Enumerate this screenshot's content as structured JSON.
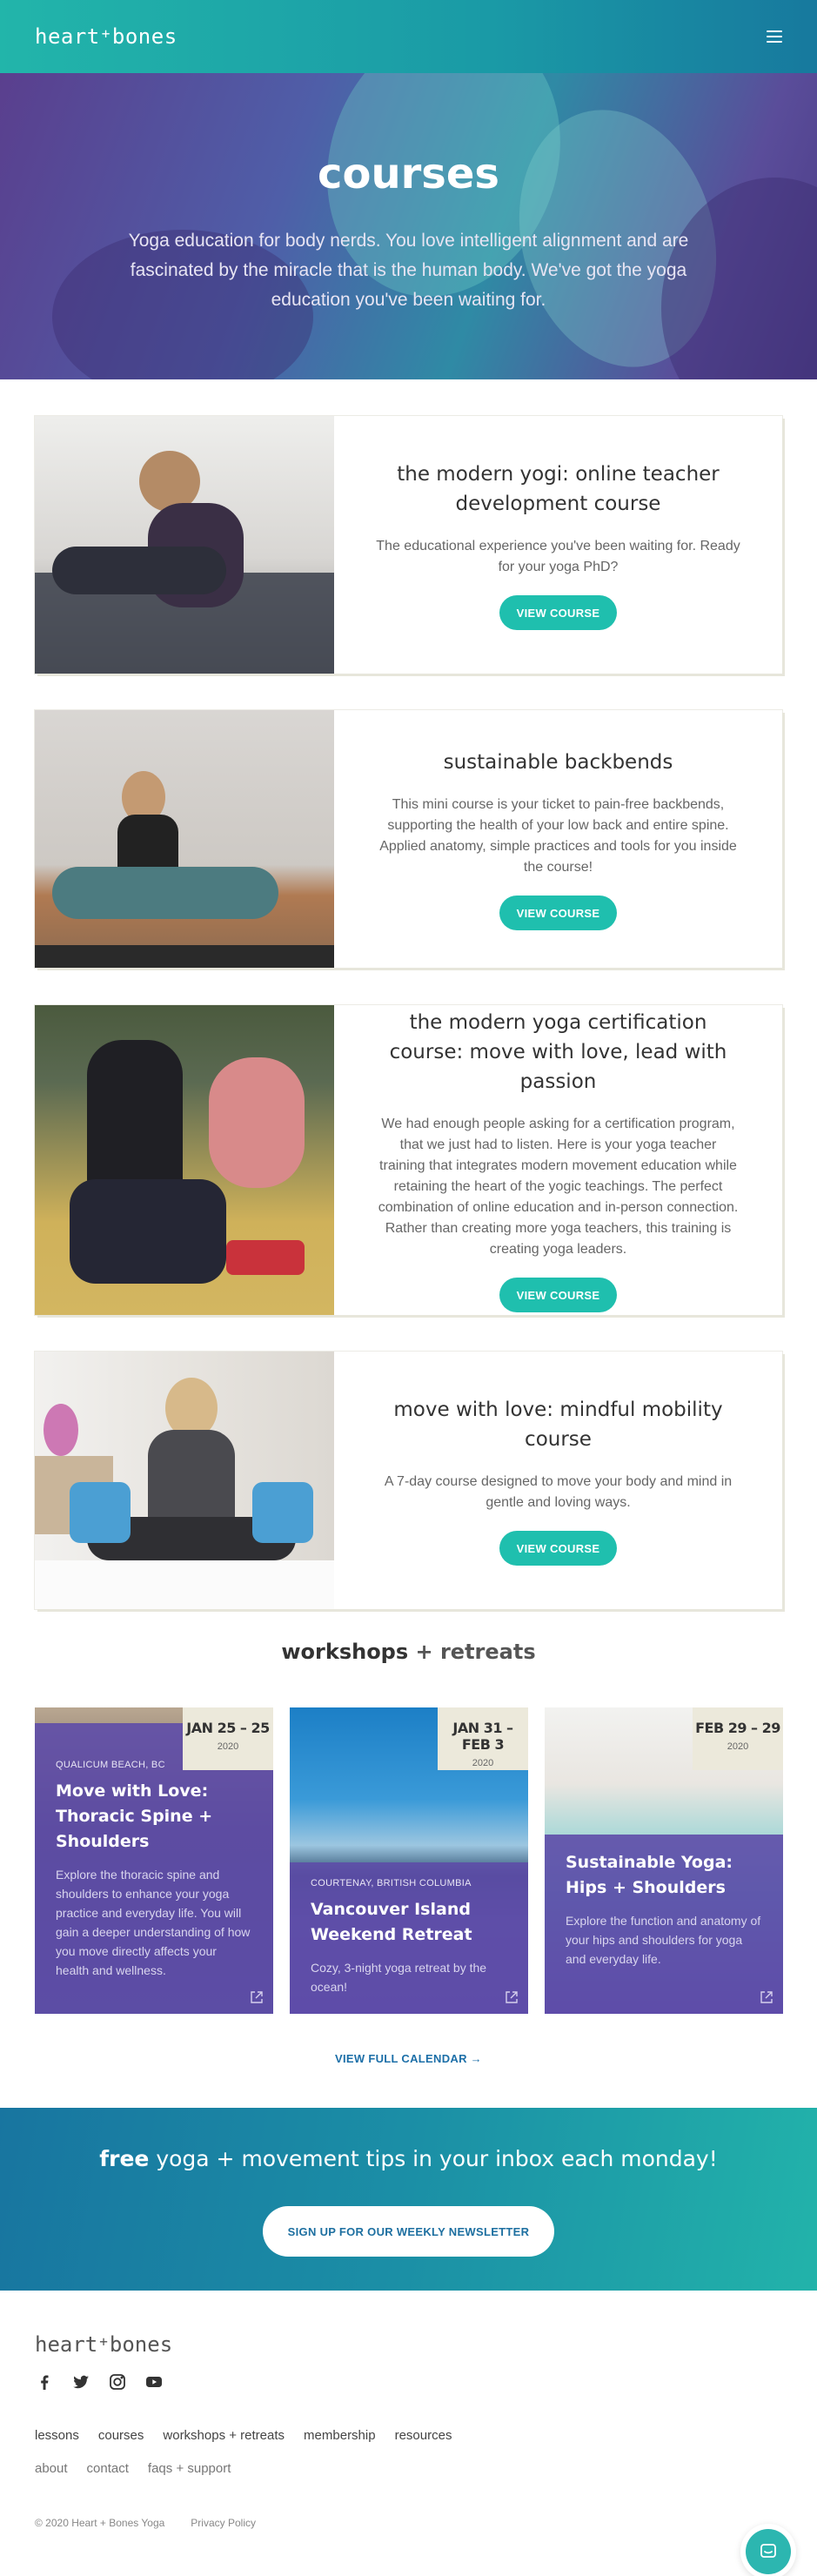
{
  "header": {
    "logo_left": "heart",
    "logo_plus": "+",
    "logo_right": "bones",
    "menu_icon": "hamburger-icon"
  },
  "hero": {
    "title": "courses",
    "text": "Yoga education for body nerds. You love intelligent alignment and are fascinated by the miracle that is the human body. We've got the yoga education you've been waiting for."
  },
  "courses": [
    {
      "title": "the modern yogi: online teacher development course",
      "description": "The educational experience you've been waiting for. Ready for your yoga PhD?",
      "button": "VIEW COURSE"
    },
    {
      "title": "sustainable backbends",
      "description": "This mini course is your ticket to pain-free backbends, supporting the health of your low back and entire spine. Applied anatomy, simple practices and tools for you inside the course!",
      "button": "VIEW COURSE"
    },
    {
      "title": "the modern yoga certification course: move with love, lead with passion",
      "description": "We had enough people asking for a certification program, that we just had to listen. Here is your yoga teacher training that integrates modern movement education while retaining the heart of the yogic teachings. The perfect combination of online education and in-person connection. Rather than creating more yoga teachers, this training is creating yoga leaders.",
      "button": "VIEW COURSE"
    },
    {
      "title": "move with love: mindful mobility course",
      "description": "A 7-day course designed to move your body and mind in gentle and loving ways.",
      "button": "VIEW COURSE"
    }
  ],
  "workshops": {
    "title_bold": "workshops",
    "title_rest": " + retreats",
    "items": [
      {
        "date": "JAN 25 – 25",
        "year": "2020",
        "location": "QUALICUM BEACH, BC",
        "title": "Move with Love: Thoracic Spine + Shoulders",
        "description": "Explore the thoracic spine and shoulders to enhance your yoga practice and everyday life. You will gain a deeper understanding of how you move directly affects your health and wellness."
      },
      {
        "date": "JAN 31 – FEB 3",
        "year": "2020",
        "location": "COURTENAY, BRITISH COLUMBIA",
        "title": "Vancouver Island Weekend Retreat",
        "description": "Cozy, 3-night yoga retreat by the ocean!"
      },
      {
        "date": "FEB 29 – 29",
        "year": "2020",
        "location": "",
        "title": "Sustainable Yoga: Hips + Shoulders",
        "description": "Explore the function and anatomy of your hips and shoulders for yoga and everyday life."
      }
    ],
    "view_calendar": "VIEW FULL CALENDAR →"
  },
  "newsletter": {
    "bold": "free",
    "text": " yoga + movement tips in your inbox each monday!",
    "button": "SIGN UP FOR OUR WEEKLY NEWSLETTER"
  },
  "footer": {
    "logo_left": "heart",
    "logo_plus": "+",
    "logo_right": "bones",
    "social": [
      "facebook-icon",
      "twitter-icon",
      "instagram-icon",
      "youtube-icon"
    ],
    "nav_primary": [
      "lessons",
      "courses",
      "workshops + retreats",
      "membership",
      "resources"
    ],
    "nav_secondary": [
      "about",
      "contact",
      "faqs + support"
    ],
    "copyright": "© 2020 Heart + Bones Yoga",
    "privacy": "Privacy Policy"
  },
  "colors": {
    "teal": "#1fbfae",
    "header_teal": "#22b5aa",
    "purple_overlay": "#5e4ca8",
    "link_blue": "#1c6fa8"
  }
}
